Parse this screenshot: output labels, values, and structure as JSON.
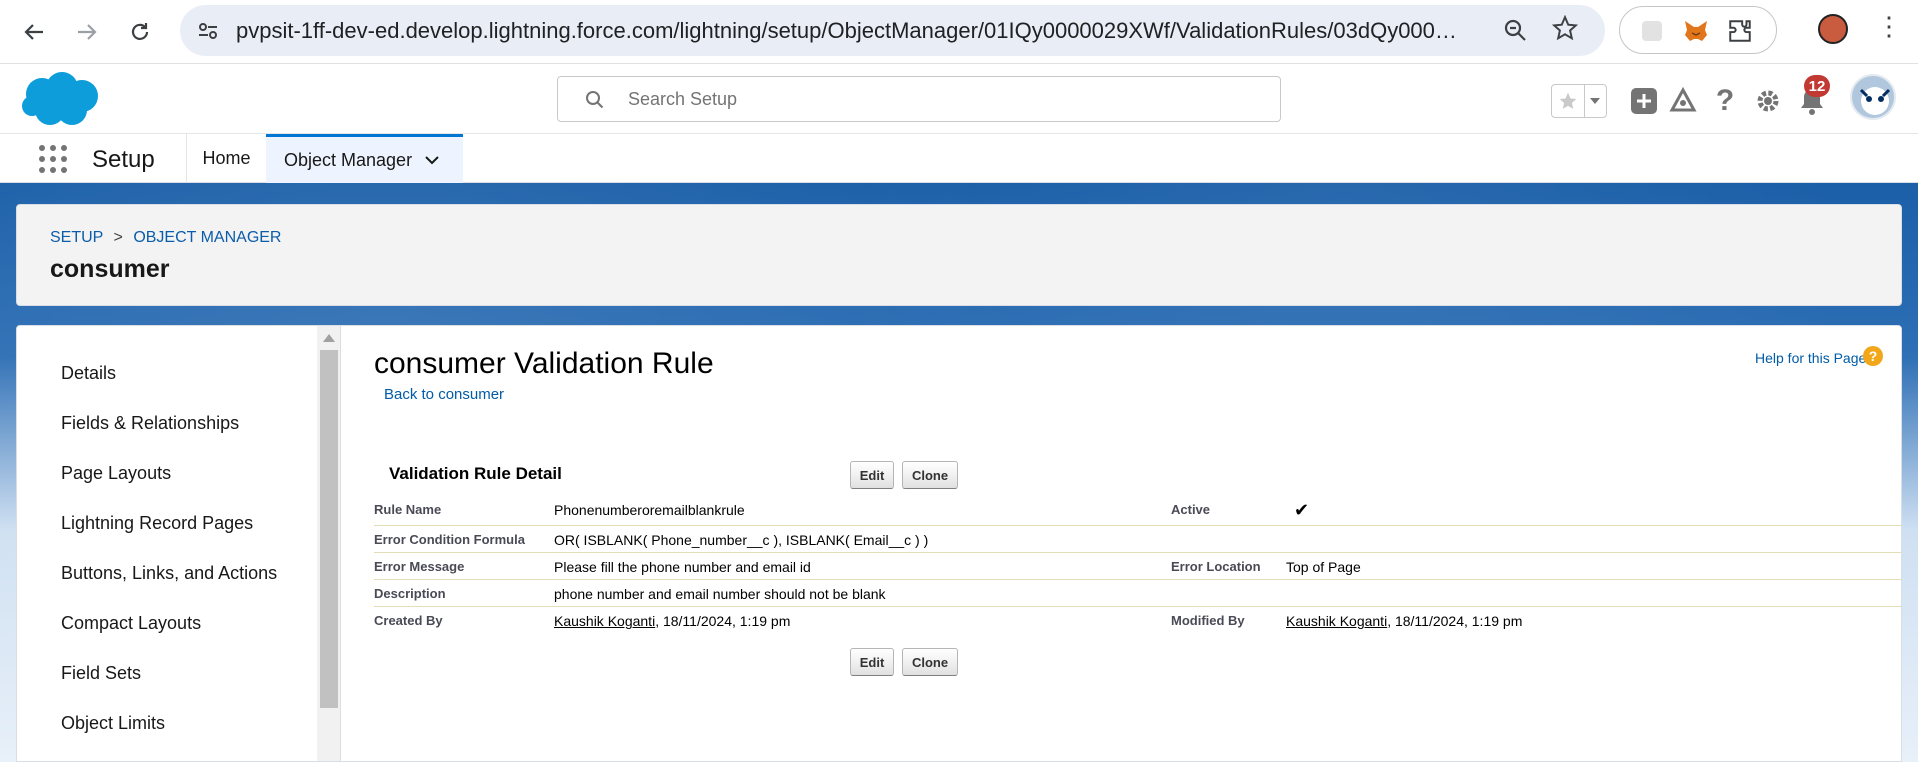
{
  "browser": {
    "url": "pvpsit-1ff-dev-ed.develop.lightning.force.com/lightning/setup/ObjectManager/01IQy0000029XWf/ValidationRules/03dQy000005w4ef..."
  },
  "global": {
    "search_placeholder": "Search Setup",
    "notification_count": "12"
  },
  "context_nav": {
    "app_name": "Setup",
    "tabs": [
      {
        "label": "Home"
      },
      {
        "label": "Object Manager"
      }
    ]
  },
  "object_header": {
    "breadcrumb": {
      "setup": "SETUP",
      "separator": ">",
      "object_manager": "OBJECT MANAGER"
    },
    "title": "consumer"
  },
  "sidebar": {
    "items": [
      {
        "label": "Details"
      },
      {
        "label": "Fields & Relationships"
      },
      {
        "label": "Page Layouts"
      },
      {
        "label": "Lightning Record Pages"
      },
      {
        "label": "Buttons, Links, and Actions"
      },
      {
        "label": "Compact Layouts"
      },
      {
        "label": "Field Sets"
      },
      {
        "label": "Object Limits"
      }
    ]
  },
  "main": {
    "page_title": "consumer Validation Rule",
    "back_link": "Back to consumer",
    "help_link": "Help for this Page",
    "help_icon_glyph": "?",
    "section_title": "Validation Rule Detail",
    "edit_label": "Edit",
    "clone_label": "Clone",
    "details": {
      "rule_name_label": "Rule Name",
      "rule_name": "Phonenumberoremailblankrule",
      "active_label": "Active",
      "active_check": "✔",
      "formula_label": "Error Condition Formula",
      "formula": "OR( ISBLANK( Phone_number__c ), ISBLANK( Email__c ) )",
      "error_message_label": "Error Message",
      "error_message": "Please fill the phone number and email id",
      "error_location_label": "Error Location",
      "error_location": "Top of Page",
      "description_label": "Description",
      "description": "phone number and email number should not be blank",
      "created_by_label": "Created By",
      "created_by_user": "Kaushik Koganti",
      "created_by_date": ", 18/11/2024, 1:19 pm",
      "modified_by_label": "Modified By",
      "modified_by_user": "Kaushik Koganti",
      "modified_by_date": ", 18/11/2024, 1:19 pm"
    }
  },
  "colors": {
    "brand_blue": "#0176d3",
    "link_blue": "#015ba7",
    "band_blue": "#1b5297",
    "badge_red": "#c23934"
  }
}
